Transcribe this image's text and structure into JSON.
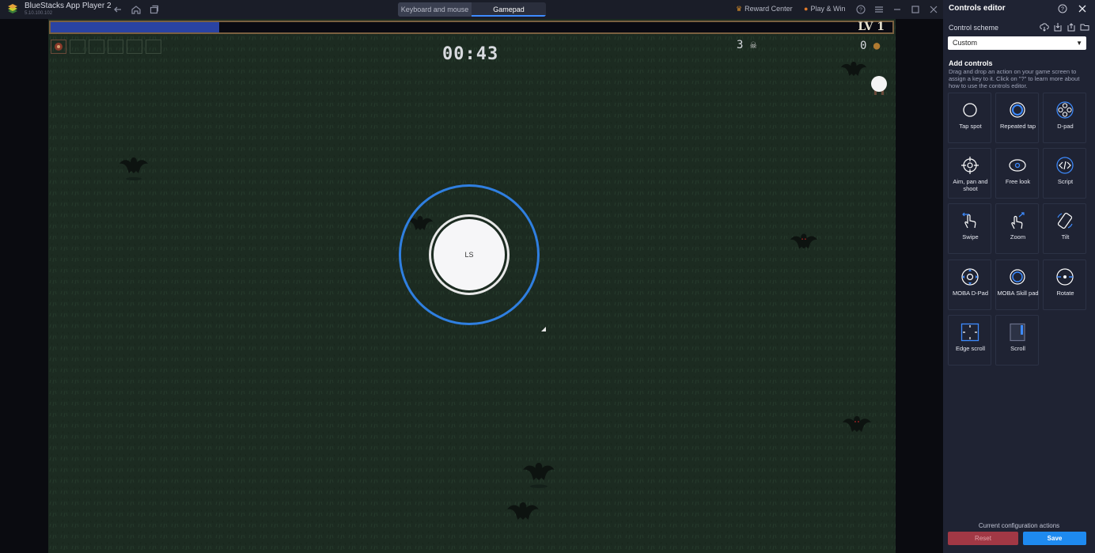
{
  "window": {
    "title": "BlueStacks App Player 2",
    "version": "5.10.100.102"
  },
  "mode_tabs": {
    "keyboard_mouse": "Keyboard and mouse",
    "gamepad": "Gamepad",
    "active": "gamepad"
  },
  "titlebar": {
    "reward_center": "Reward Center",
    "play_win": "Play & Win"
  },
  "game": {
    "level": "LV 1",
    "timer": "00:43",
    "kills": "3",
    "coins": "0",
    "xp_progress": 0.2,
    "joystick_label": "LS"
  },
  "panel": {
    "title": "Controls editor",
    "scheme_label": "Control scheme",
    "scheme_value": "Custom",
    "add_controls_title": "Add controls",
    "add_controls_desc": "Drag and drop an action on your game screen to assign a key to it. Click on \"?\" to learn more about how to use the controls editor.",
    "controls": [
      {
        "label": "Tap spot",
        "icon": "tap-spot-icon"
      },
      {
        "label": "Repeated tap",
        "icon": "repeated-tap-icon"
      },
      {
        "label": "D-pad",
        "icon": "d-pad-icon"
      },
      {
        "label": "Aim, pan and shoot",
        "icon": "aim-pan-shoot-icon"
      },
      {
        "label": "Free look",
        "icon": "free-look-icon"
      },
      {
        "label": "Script",
        "icon": "script-icon"
      },
      {
        "label": "Swipe",
        "icon": "swipe-icon"
      },
      {
        "label": "Zoom",
        "icon": "zoom-icon"
      },
      {
        "label": "Tilt",
        "icon": "tilt-icon"
      },
      {
        "label": "MOBA D-Pad",
        "icon": "moba-d-pad-icon"
      },
      {
        "label": "MOBA Skill pad",
        "icon": "moba-skill-pad-icon"
      },
      {
        "label": "Rotate",
        "icon": "rotate-icon"
      },
      {
        "label": "Edge scroll",
        "icon": "edge-scroll-icon"
      },
      {
        "label": "Scroll",
        "icon": "scroll-icon"
      }
    ],
    "config_label": "Current configuration actions",
    "reset_label": "Reset",
    "save_label": "Save"
  },
  "colors": {
    "accent": "#1e8af0",
    "joystick_ring": "#2f7fe0",
    "reset": "#a13845",
    "panel_bg": "#1f2333",
    "xp_fill": "#2a43a3"
  }
}
